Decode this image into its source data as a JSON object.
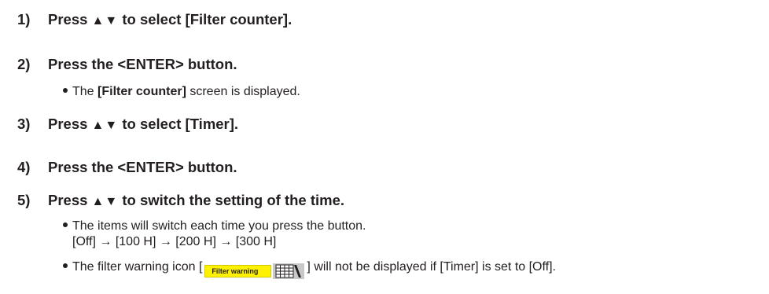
{
  "steps": [
    {
      "num": "1)",
      "pre": "Press ",
      "arrows": "▲▼",
      "post": " to select [Filter counter]."
    },
    {
      "num": "2)",
      "text": "Press the <ENTER> button."
    },
    {
      "num": "3)",
      "pre": "Press ",
      "arrows": "▲▼",
      "post": " to select [Timer]."
    },
    {
      "num": "4)",
      "text": "Press the <ENTER> button."
    },
    {
      "num": "5)",
      "pre": "Press ",
      "arrows": "▲▼",
      "post": " to switch the setting of the time."
    }
  ],
  "notes": {
    "step2": {
      "pre": "The ",
      "bold": "[Filter counter]",
      "post": " screen is displayed."
    },
    "step5_a": "The items will switch each time you press the button.",
    "step5_sequence": "[Off] → [100 H] → [200 H] → [300 H]",
    "step5_b_pre": "The filter warning icon [",
    "step5_b_icon_label": "Filter warning",
    "step5_b_post": "] will not be displayed if [Timer] is set to [Off]."
  },
  "icons": {
    "bullet": "bullet-dot",
    "arrows": "up-down-triangle",
    "warning": "filter-warning-icon",
    "warning_color": "#fff200"
  }
}
